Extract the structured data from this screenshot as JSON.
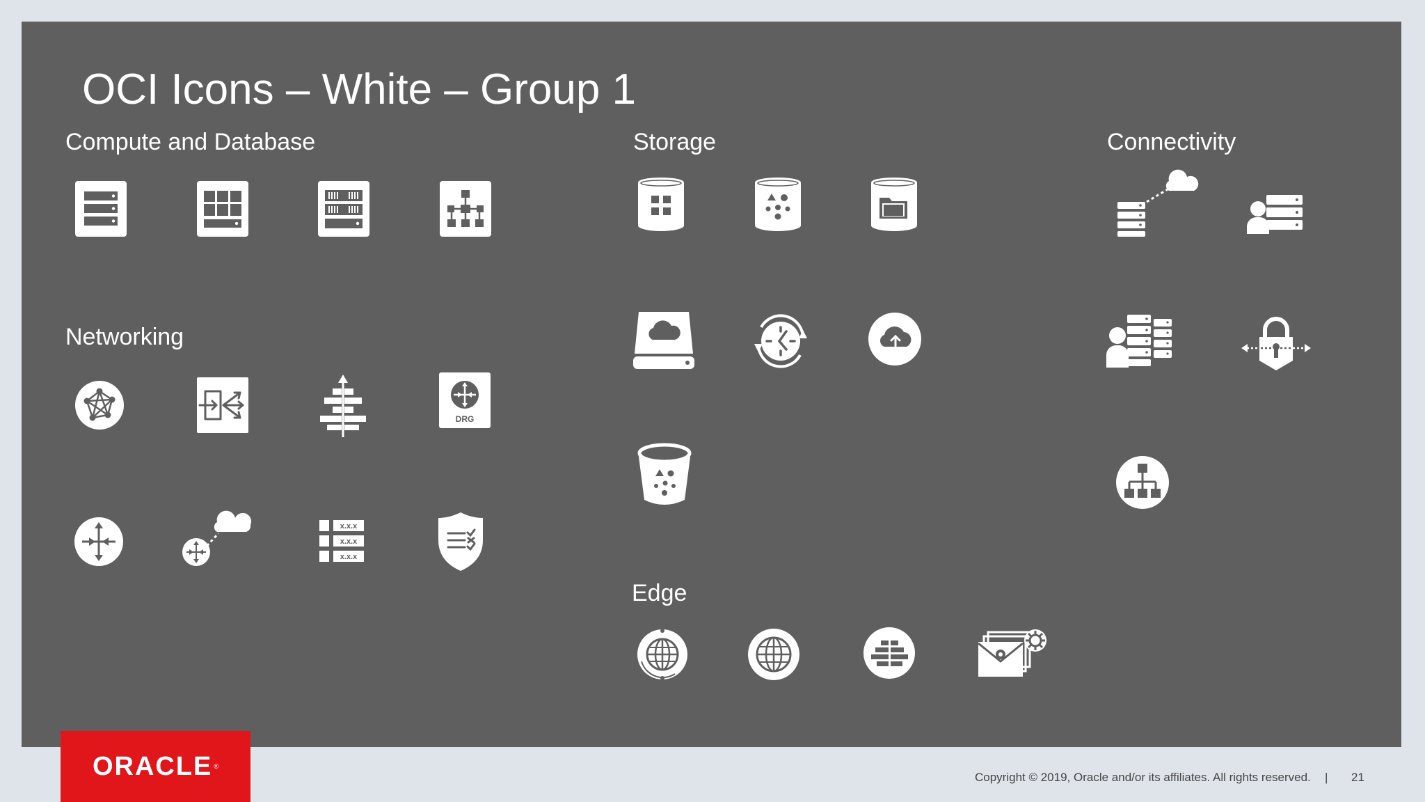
{
  "slide": {
    "title": "OCI Icons – White – Group 1",
    "page_number": "21"
  },
  "sections": {
    "compute": "Compute and Database",
    "storage": "Storage",
    "connectivity": "Connectivity",
    "networking": "Networking",
    "edge": "Edge"
  },
  "icon_labels": {
    "drg": "DRG",
    "route_entry": "x.x.x"
  },
  "brand": {
    "logo_text": "ORACLE",
    "logo_mark": "®",
    "accent_color": "#e0161b",
    "slide_color": "#5f5f5f",
    "page_color": "#dfe4ea",
    "icon_color": "#ffffff"
  },
  "footer": {
    "copyright": "Copyright © 2019, Oracle and/or its affiliates. All rights reserved.",
    "separator": "|"
  }
}
